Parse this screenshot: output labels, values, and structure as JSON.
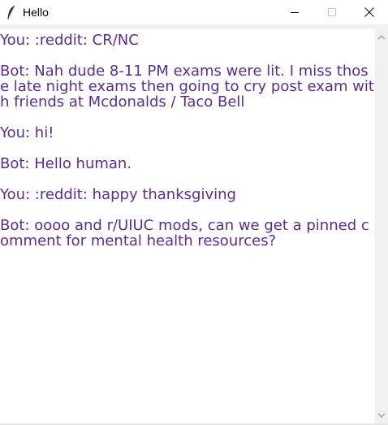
{
  "window": {
    "title": "Hello"
  },
  "icons": {
    "app": "feather-icon",
    "minimize": "minimize-icon",
    "maximize": "maximize-icon",
    "close": "close-icon",
    "scroll_up": "chevron-up-icon",
    "scroll_down": "chevron-down-icon"
  },
  "colors": {
    "chat_text": "#5b2e8a"
  },
  "chat": {
    "text": "You: :reddit: CR/NC\n\nBot: Nah dude 8-11 PM exams were lit. I miss those late night exams then going to cry post exam with friends at Mcdonalds / Taco Bell\n\nYou: hi!\n\nBot: Hello human.\n\nYou: :reddit: happy thanksgiving\n\nBot: oooo and r/UIUC mods, can we get a pinned comment for mental health resources?"
  }
}
